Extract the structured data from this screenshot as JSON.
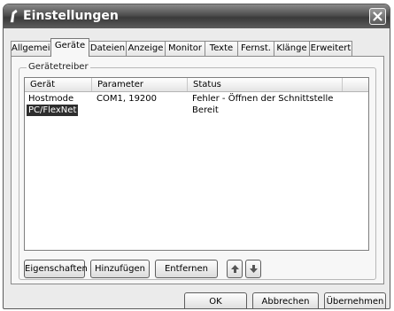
{
  "window": {
    "title": "Einstellungen"
  },
  "tabs": [
    {
      "label": "Allgemein",
      "active": false
    },
    {
      "label": "Geräte",
      "active": true
    },
    {
      "label": "Dateien",
      "active": false
    },
    {
      "label": "Anzeige",
      "active": false
    },
    {
      "label": "Monitor",
      "active": false
    },
    {
      "label": "Texte",
      "active": false
    },
    {
      "label": "Fernst.",
      "active": false
    },
    {
      "label": "Klänge",
      "active": false
    },
    {
      "label": "Erweitert",
      "active": false
    }
  ],
  "group": {
    "label": "Gerätetreiber"
  },
  "list": {
    "columns": [
      "Gerät",
      "Parameter",
      "Status"
    ],
    "rows": [
      {
        "device": "Hostmode",
        "parameter": "COM1, 19200",
        "status": "Fehler - Öffnen der Schnittstelle",
        "selected": false
      },
      {
        "device": "PC/FlexNet",
        "parameter": "",
        "status": "Bereit",
        "selected": true
      }
    ]
  },
  "actions": {
    "properties": "Eigenschaften",
    "add": "Hinzufügen",
    "remove": "Entfernen",
    "up_icon": "arrow-up-icon",
    "down_icon": "arrow-down-icon"
  },
  "footer": {
    "ok": "OK",
    "cancel": "Abbrechen",
    "apply": "Übernehmen"
  }
}
